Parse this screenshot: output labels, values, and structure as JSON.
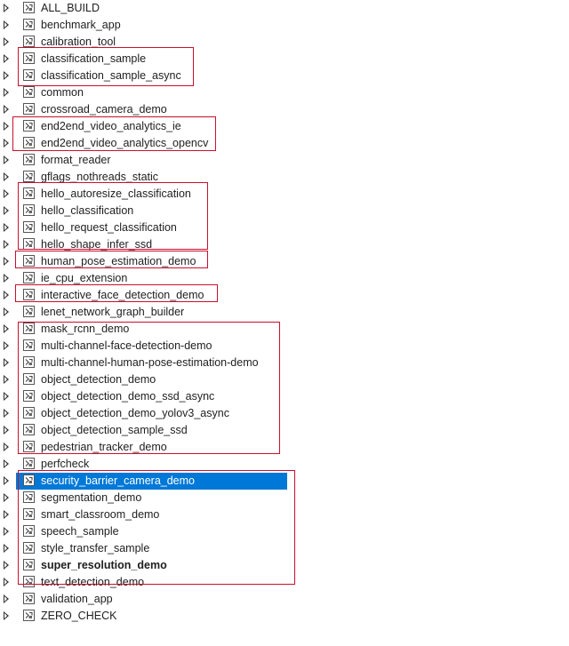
{
  "tree": {
    "items": [
      {
        "label": "ALL_BUILD"
      },
      {
        "label": "benchmark_app"
      },
      {
        "label": "calibration_tool"
      },
      {
        "label": "classification_sample"
      },
      {
        "label": "classification_sample_async"
      },
      {
        "label": "common"
      },
      {
        "label": "crossroad_camera_demo"
      },
      {
        "label": "end2end_video_analytics_ie"
      },
      {
        "label": "end2end_video_analytics_opencv"
      },
      {
        "label": "format_reader"
      },
      {
        "label": "gflags_nothreads_static"
      },
      {
        "label": "hello_autoresize_classification"
      },
      {
        "label": "hello_classification"
      },
      {
        "label": "hello_request_classification"
      },
      {
        "label": "hello_shape_infer_ssd"
      },
      {
        "label": "human_pose_estimation_demo"
      },
      {
        "label": "ie_cpu_extension"
      },
      {
        "label": "interactive_face_detection_demo"
      },
      {
        "label": "lenet_network_graph_builder"
      },
      {
        "label": "mask_rcnn_demo"
      },
      {
        "label": "multi-channel-face-detection-demo"
      },
      {
        "label": "multi-channel-human-pose-estimation-demo"
      },
      {
        "label": "object_detection_demo"
      },
      {
        "label": "object_detection_demo_ssd_async"
      },
      {
        "label": "object_detection_demo_yolov3_async"
      },
      {
        "label": "object_detection_sample_ssd"
      },
      {
        "label": "pedestrian_tracker_demo"
      },
      {
        "label": "perfcheck"
      },
      {
        "label": "security_barrier_camera_demo",
        "selected": true
      },
      {
        "label": "segmentation_demo"
      },
      {
        "label": "smart_classroom_demo"
      },
      {
        "label": "speech_sample"
      },
      {
        "label": "style_transfer_sample"
      },
      {
        "label": "super_resolution_demo",
        "bold": true
      },
      {
        "label": "text_detection_demo"
      },
      {
        "label": "validation_app"
      },
      {
        "label": "ZERO_CHECK"
      }
    ]
  },
  "colors": {
    "selection": "#0078d7",
    "highlight_box": "#c8102e"
  },
  "icons": {
    "expander": "chevron-right-icon",
    "project": "vc-project-icon"
  }
}
